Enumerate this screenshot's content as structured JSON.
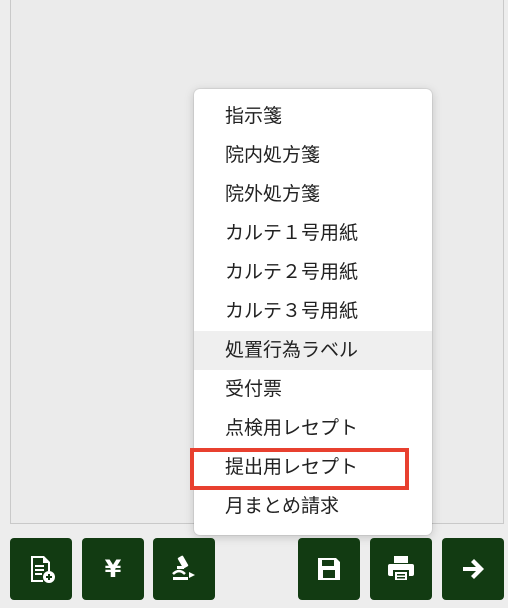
{
  "menu": {
    "items": [
      {
        "label": "指示箋"
      },
      {
        "label": "院内処方箋"
      },
      {
        "label": "院外処方箋"
      },
      {
        "label": "カルテ１号用紙"
      },
      {
        "label": "カルテ２号用紙"
      },
      {
        "label": "カルテ３号用紙"
      },
      {
        "label": "処置行為ラベル"
      },
      {
        "label": "受付票"
      },
      {
        "label": "点検用レセプト"
      },
      {
        "label": "提出用レセプト"
      },
      {
        "label": "月まとめ請求"
      }
    ],
    "hovered_item": "処置行為ラベル",
    "highlighted_item": "提出用レセプト"
  },
  "toolbar": {
    "buttons": [
      {
        "icon": "document-add-icon"
      },
      {
        "icon": "yen-icon",
        "glyph": "¥"
      },
      {
        "icon": "microscope-icon"
      },
      {
        "icon": "save-icon"
      },
      {
        "icon": "print-icon"
      },
      {
        "icon": "arrow-right-icon"
      }
    ]
  },
  "colors": {
    "button_bg": "#123b12",
    "highlight_border": "#e8402f",
    "menu_bg": "#ffffff",
    "hover_bg": "#efefef"
  }
}
